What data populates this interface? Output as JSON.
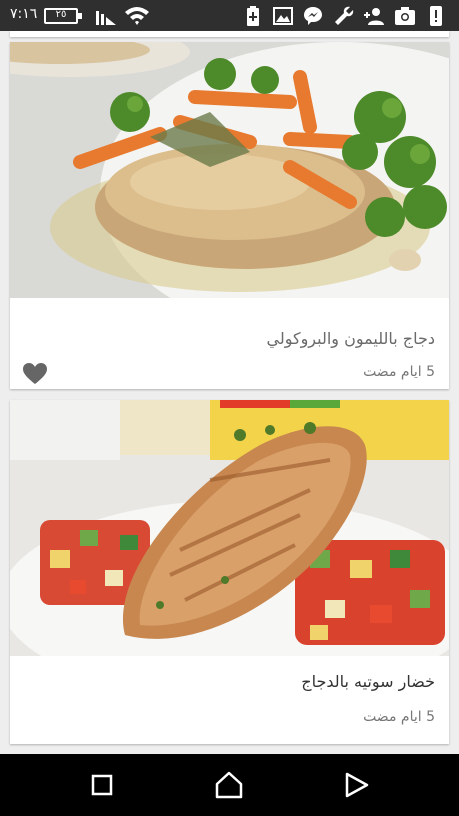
{
  "status_bar": {
    "time": "٧:١٦",
    "battery_level": "٢٥",
    "icons": [
      "battery-icon",
      "signal-icon",
      "wifi-icon",
      "battery-saver-icon",
      "image-icon",
      "messenger-icon",
      "wrench-icon",
      "add-person-icon",
      "camera-icon",
      "alert-icon"
    ]
  },
  "feed": {
    "cards": [
      {
        "title": "دجاج بالليمون والبروكولي",
        "time_ago": "5 ايام مضت",
        "liked": true
      },
      {
        "title": "خضار سوتيه بالدجاج",
        "time_ago": "5 ايام مضت",
        "liked": false
      }
    ]
  },
  "nav_bar": {
    "buttons": [
      "recents-button",
      "home-button",
      "back-button"
    ]
  },
  "colors": {
    "status_bar": "#2f2f2f",
    "background": "#eeeeee",
    "nav_bar": "#000000",
    "heart": "#666666"
  }
}
